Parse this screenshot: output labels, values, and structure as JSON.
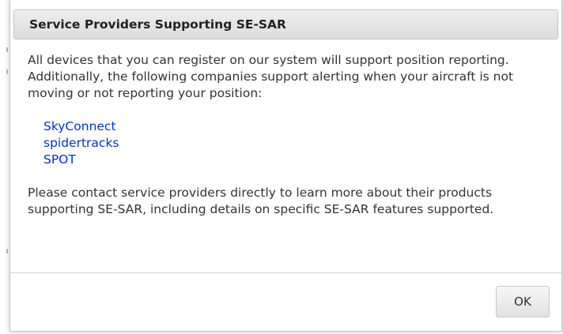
{
  "dialog": {
    "title": "Service Providers Supporting SE-SAR",
    "intro": "All devices that you can register on our system will support position reporting. Additionally, the following companies support alerting when your aircraft is not moving or not reporting your position:",
    "providers": [
      {
        "label": "SkyConnect"
      },
      {
        "label": "spidertracks"
      },
      {
        "label": "SPOT"
      }
    ],
    "closing": "Please contact service providers directly to learn more about their products supporting SE-SAR, including details on specific SE-SAR features supported.",
    "ok_label": "OK"
  },
  "colors": {
    "link": "#0033cc",
    "text": "#333333",
    "title_bar": "#e4e4e4"
  }
}
